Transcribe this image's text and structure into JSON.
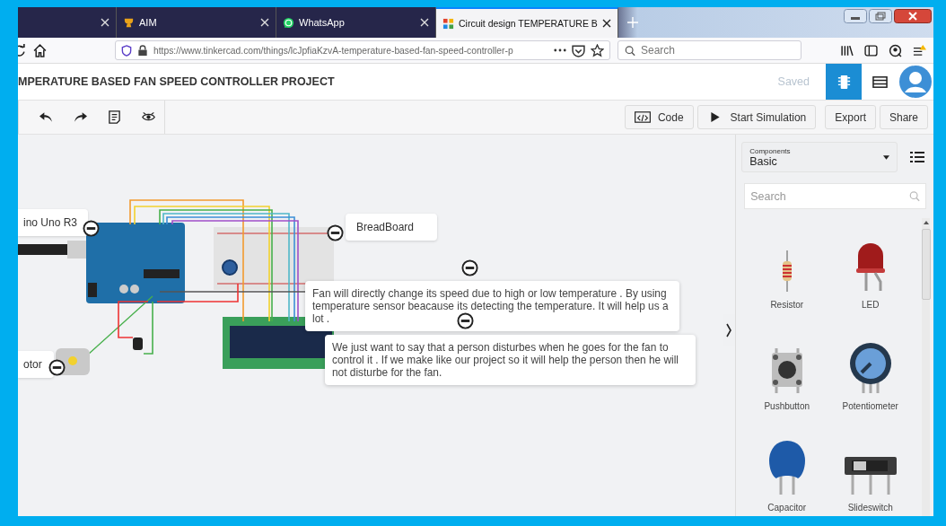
{
  "browser": {
    "tabs": [
      {
        "kind": "blank",
        "selected": false
      },
      {
        "kind": "trophy",
        "title": "AIM",
        "selected": false
      },
      {
        "kind": "chat",
        "title": "WhatsApp",
        "selected": false
      },
      {
        "kind": "grid",
        "title": "Circuit design TEMPERATURE B",
        "selected": true
      }
    ],
    "url": "https://www.tinkercad.com/things/lcJpfiaKzvA-temperature-based-fan-speed-controller-p",
    "search_placeholder": "Search"
  },
  "project": {
    "title": "MPERATURE BASED FAN SPEED CONTROLLER PROJECT",
    "status": "Saved",
    "views": [
      {
        "kind": "circuit",
        "selected": true
      },
      {
        "kind": "list",
        "selected": false
      }
    ]
  },
  "toolbar": {
    "buttons": [
      {
        "kind": "code",
        "label": "Code"
      },
      {
        "kind": "play",
        "label": "Start Simulation"
      },
      {
        "kind": "plain",
        "label": "Export"
      },
      {
        "kind": "plain",
        "label": "Share"
      }
    ]
  },
  "canvas": {
    "labels": [
      "ino Uno R3",
      "BreadBoard",
      "otor"
    ],
    "notes": [
      "Fan will directly change its speed due to high or low temperature . By using temperature sensor beacause its detecting the temperature. It will help us a lot .",
      "We just want to say that a person disturbes when he goes for the fan to control it . If we make like our project so it will help the person then he will not disturbe for the fan."
    ]
  },
  "components_panel": {
    "dropdown_label": "Components",
    "dropdown_value": "Basic",
    "search_placeholder": "Search",
    "items": [
      {
        "kind": "resistor",
        "name": "Resistor"
      },
      {
        "kind": "led",
        "name": "LED"
      },
      {
        "kind": "pushbutton",
        "name": "Pushbutton"
      },
      {
        "kind": "potentiometer",
        "name": "Potentiometer"
      },
      {
        "kind": "capacitor",
        "name": "Capacitor"
      },
      {
        "kind": "slideswitch",
        "name": "Slideswitch"
      }
    ]
  }
}
